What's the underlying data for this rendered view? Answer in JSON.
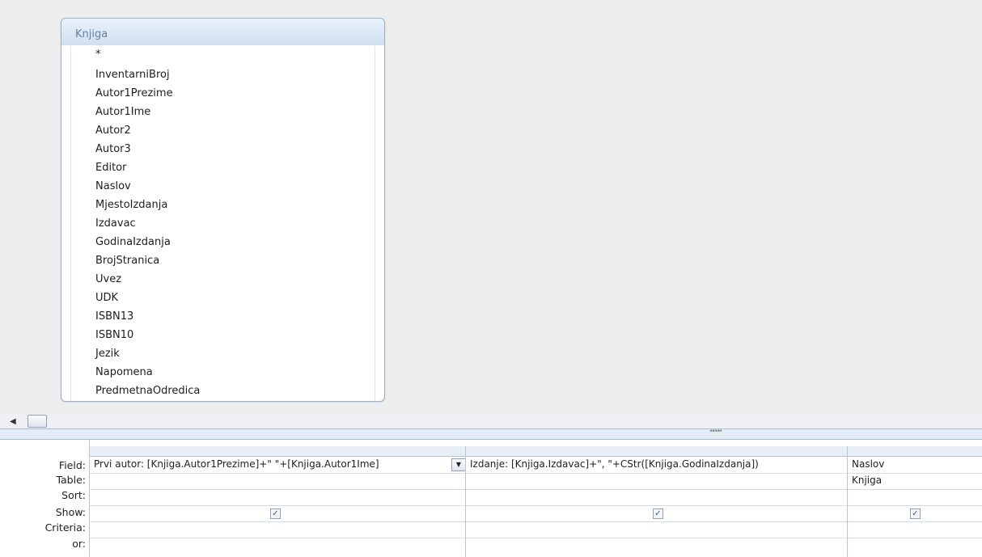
{
  "table": {
    "title": "Knjiga",
    "fields": [
      "*",
      "InventarniBroj",
      "Autor1Prezime",
      "Autor1Ime",
      "Autor2",
      "Autor3",
      "Editor",
      "Naslov",
      "MjestoIzdanja",
      "Izdavac",
      "GodinaIzdanja",
      "BrojStranica",
      "Uvez",
      "UDK",
      "ISBN13",
      "ISBN10",
      "Jezik",
      "Napomena",
      "PredmetnaOdredica"
    ]
  },
  "grid": {
    "row_labels": {
      "field": "Field:",
      "table": "Table:",
      "sort": "Sort:",
      "show": "Show:",
      "criteria": "Criteria:",
      "or": "or:"
    },
    "columns": [
      {
        "field": "Prvi autor: [Knjiga.Autor1Prezime]+\" \"+[Knjiga.Autor1Ime]",
        "table": "",
        "show": true
      },
      {
        "field": "Izdanje: [Knjiga.Izdavac]+\", \"+CStr([Knjiga.GodinaIzdanja])",
        "table": "",
        "show": true
      },
      {
        "field": "Naslov",
        "table": "Knjiga",
        "show": true
      }
    ]
  },
  "icons": {
    "scroll_left": "scroll-left-arrow-icon",
    "scroll_thumb": "scroll-thumb-grip-icon",
    "splitter": "splitter-grip-icon",
    "dropdown": "dropdown-arrow-icon",
    "checkbox": "checkbox-checked-icon"
  }
}
